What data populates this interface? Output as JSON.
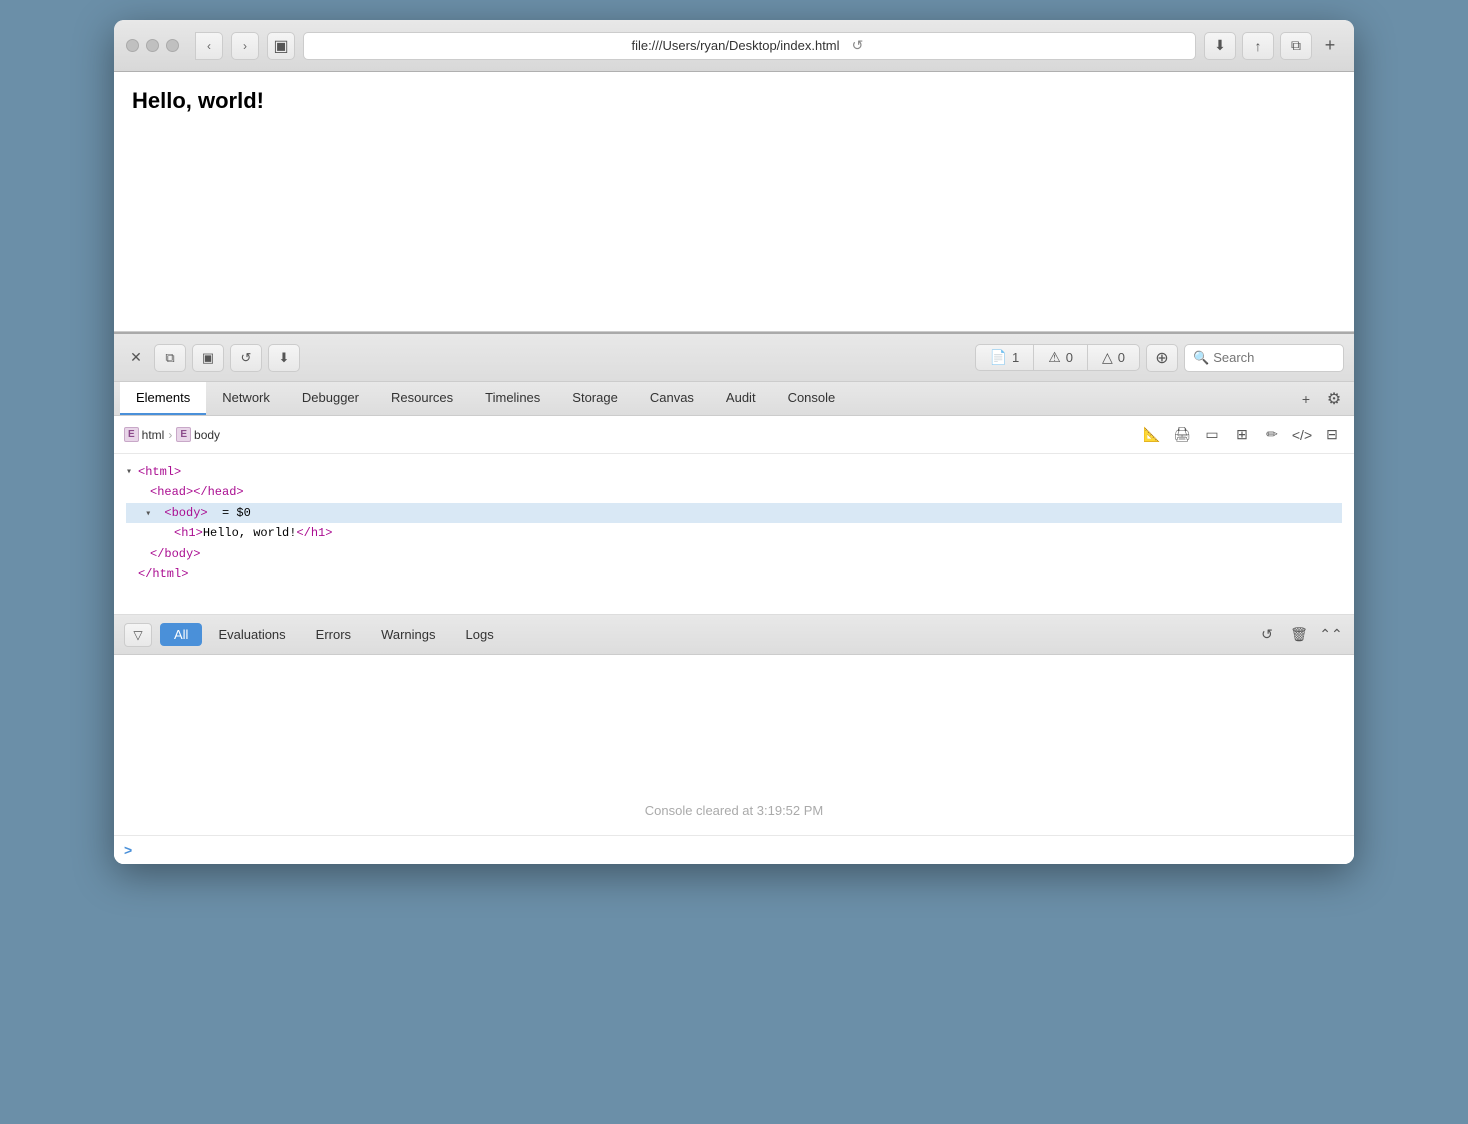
{
  "browser": {
    "url": "file:///Users/ryan/Desktop/index.html",
    "title": "Hello, world!",
    "page_content": "Hello, world!"
  },
  "titlebar": {
    "back_label": "‹",
    "forward_label": "›",
    "sidebar_icon": "▣",
    "refresh_label": "↺",
    "download_icon": "⬇",
    "share_icon": "↑",
    "tab_icon": "⧉",
    "add_tab_label": "+"
  },
  "devtools": {
    "close_label": "✕",
    "icon1": "⧉",
    "icon2": "▣",
    "icon3": "↺",
    "icon4": "⬇",
    "counters": {
      "pages": "1",
      "errors": "0",
      "warnings": "0"
    },
    "search_placeholder": "Search",
    "tabs": [
      {
        "id": "elements",
        "label": "Elements",
        "active": true
      },
      {
        "id": "network",
        "label": "Network"
      },
      {
        "id": "debugger",
        "label": "Debugger"
      },
      {
        "id": "resources",
        "label": "Resources"
      },
      {
        "id": "timelines",
        "label": "Timelines"
      },
      {
        "id": "storage",
        "label": "Storage"
      },
      {
        "id": "canvas",
        "label": "Canvas"
      },
      {
        "id": "audit",
        "label": "Audit"
      },
      {
        "id": "console",
        "label": "Console"
      }
    ]
  },
  "elements_panel": {
    "breadcrumb": {
      "html_label": "html",
      "body_label": "body"
    },
    "dom": {
      "line1": "▾ <html>",
      "line2": "    <head></head>",
      "line3": "▾ <body> = $0",
      "line4": "      <h1>Hello, world!</h1>",
      "line5": "    </body>",
      "line6": "  </html>"
    }
  },
  "console": {
    "filter_tabs": [
      {
        "id": "all",
        "label": "All",
        "active": true
      },
      {
        "id": "evaluations",
        "label": "Evaluations"
      },
      {
        "id": "errors",
        "label": "Errors"
      },
      {
        "id": "warnings",
        "label": "Warnings"
      },
      {
        "id": "logs",
        "label": "Logs"
      }
    ],
    "cleared_message": "Console cleared at 3:19:52 PM",
    "prompt": ">"
  },
  "colors": {
    "accent_blue": "#4a90d9",
    "tag_purple": "#aa0d91",
    "selected_bg": "#d9e8f5"
  }
}
